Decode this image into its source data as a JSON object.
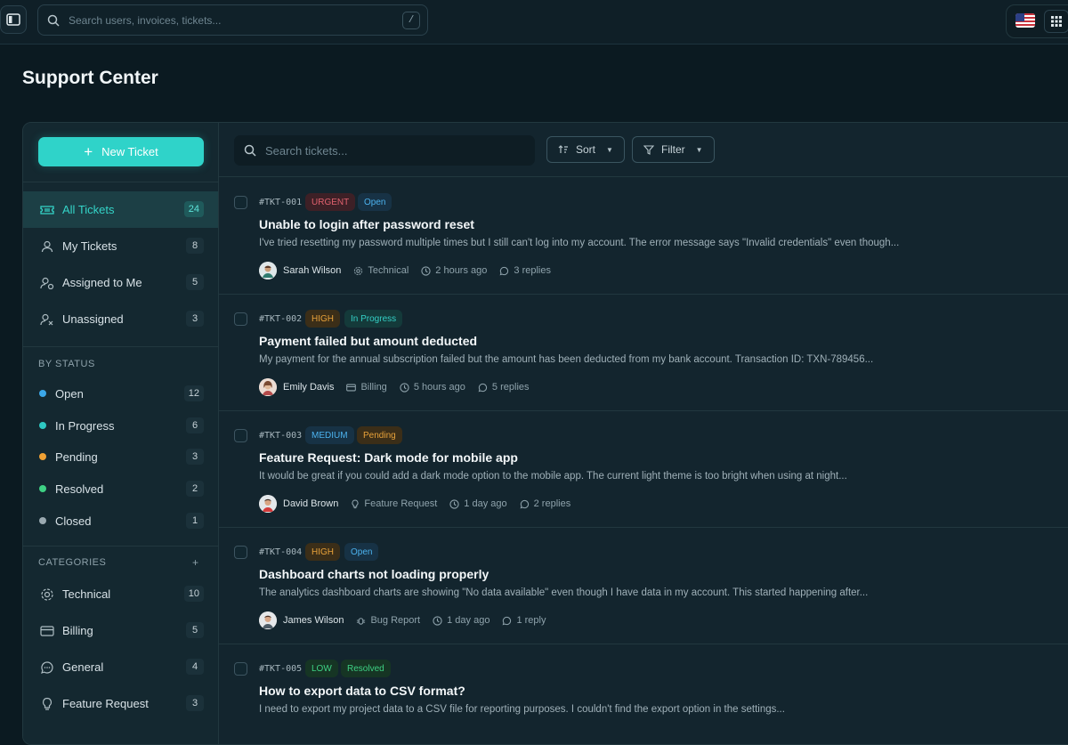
{
  "topbar": {
    "search_placeholder": "Search users, invoices, tickets...",
    "search_shortcut": "/"
  },
  "page": {
    "title": "Support Center"
  },
  "sidebar": {
    "new_ticket_label": "New Ticket",
    "views": [
      {
        "label": "All Tickets",
        "count": "24",
        "icon": "ticket-icon",
        "active": true
      },
      {
        "label": "My Tickets",
        "count": "8",
        "icon": "user-icon"
      },
      {
        "label": "Assigned to Me",
        "count": "5",
        "icon": "user-check-icon"
      },
      {
        "label": "Unassigned",
        "count": "3",
        "icon": "user-x-icon"
      }
    ],
    "by_status_heading": "BY STATUS",
    "statuses": [
      {
        "label": "Open",
        "count": "12",
        "color": "#3ba7e8"
      },
      {
        "label": "In Progress",
        "count": "6",
        "color": "#2ec8c2"
      },
      {
        "label": "Pending",
        "count": "3",
        "color": "#f0a134"
      },
      {
        "label": "Resolved",
        "count": "2",
        "color": "#3ed184"
      },
      {
        "label": "Closed",
        "count": "1",
        "color": "#9aa9b0"
      }
    ],
    "categories_heading": "CATEGORIES",
    "categories_add": "+",
    "categories": [
      {
        "label": "Technical",
        "count": "10",
        "icon": "gear-icon"
      },
      {
        "label": "Billing",
        "count": "5",
        "icon": "credit-card-icon"
      },
      {
        "label": "General",
        "count": "4",
        "icon": "chat-icon"
      },
      {
        "label": "Feature Request",
        "count": "3",
        "icon": "lightbulb-icon"
      }
    ]
  },
  "toolbar": {
    "search_placeholder": "Search tickets...",
    "sort_label": "Sort",
    "filter_label": "Filter"
  },
  "tickets": [
    {
      "id": "#TKT-001",
      "priority": "URGENT",
      "status": "Open",
      "title": "Unable to login after password reset",
      "desc": "I've tried resetting my password multiple times but I still can't log into my account. The error message says \"Invalid credentials\" even though...",
      "author": "Sarah Wilson",
      "category": "Technical",
      "time": "2 hours ago",
      "replies": "3 replies"
    },
    {
      "id": "#TKT-002",
      "priority": "HIGH",
      "status": "In Progress",
      "title": "Payment failed but amount deducted",
      "desc": "My payment for the annual subscription failed but the amount has been deducted from my bank account. Transaction ID: TXN-789456...",
      "author": "Emily Davis",
      "category": "Billing",
      "time": "5 hours ago",
      "replies": "5 replies"
    },
    {
      "id": "#TKT-003",
      "priority": "MEDIUM",
      "status": "Pending",
      "title": "Feature Request: Dark mode for mobile app",
      "desc": "It would be great if you could add a dark mode option to the mobile app. The current light theme is too bright when using at night...",
      "author": "David Brown",
      "category": "Feature Request",
      "time": "1 day ago",
      "replies": "2 replies"
    },
    {
      "id": "#TKT-004",
      "priority": "HIGH",
      "status": "Open",
      "title": "Dashboard charts not loading properly",
      "desc": "The analytics dashboard charts are showing \"No data available\" even though I have data in my account. This started happening after...",
      "author": "James Wilson",
      "category": "Bug Report",
      "time": "1 day ago",
      "replies": "1 reply"
    },
    {
      "id": "#TKT-005",
      "priority": "LOW",
      "status": "Resolved",
      "title": "How to export data to CSV format?",
      "desc": "I need to export my project data to a CSV file for reporting purposes. I couldn't find the export option in the settings...",
      "author": "",
      "category": "",
      "time": "",
      "replies": ""
    }
  ],
  "colors": {
    "accent": "#2fd3c9",
    "urgent": "#e0616e",
    "high": "#e8a23a",
    "medium": "#3ba7e8",
    "low": "#3ed184",
    "open": "#3ba7e8",
    "in_progress": "#2ec8c2",
    "pending": "#e8a23a",
    "resolved": "#3ed184"
  }
}
